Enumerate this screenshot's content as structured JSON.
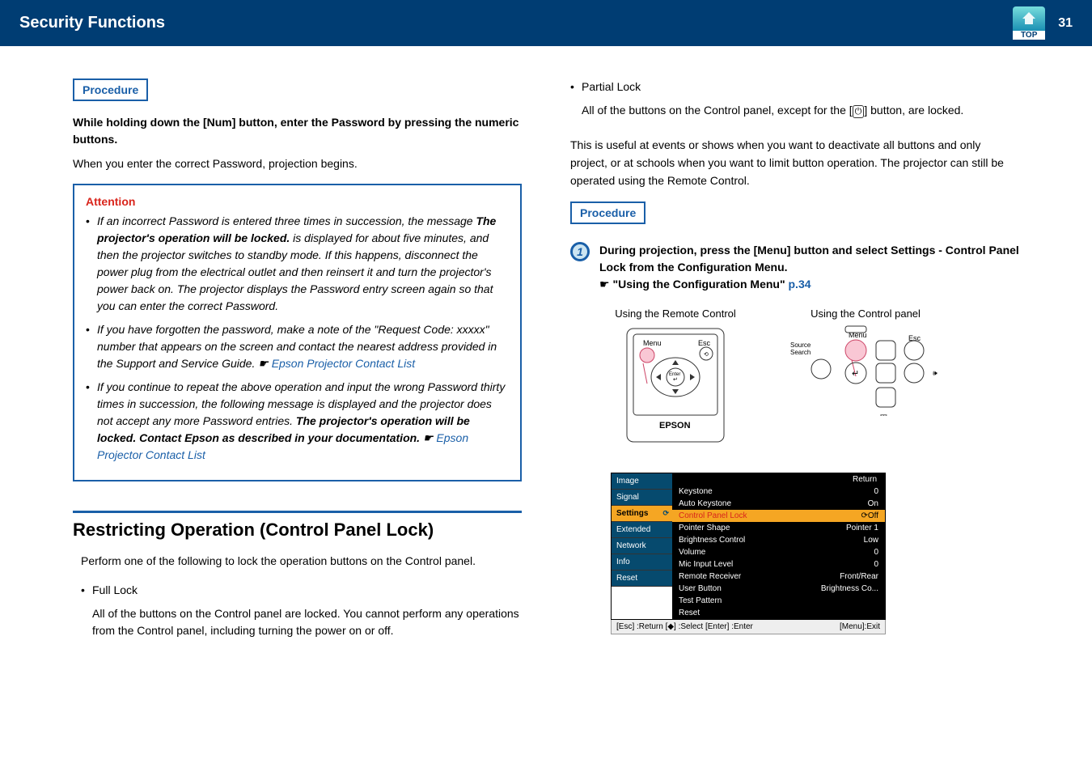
{
  "header": {
    "title": "Security Functions",
    "page": "31",
    "top": "TOP"
  },
  "left": {
    "procLabel": "Procedure",
    "instr": "While holding down the [Num] button, enter the Password by pressing the numeric buttons.",
    "after": "When you enter the correct Password, projection begins.",
    "attTitle": "Attention",
    "att1a": "If an incorrect Password is entered three times in succession, the message ",
    "att1b": "The projector's operation will be locked.",
    "att1c": " is displayed for about five minutes, and then the projector switches to standby mode. If this happens, disconnect the power plug from the electrical outlet and then reinsert it and turn the projector's power back on. The projector displays the Password entry screen again so that you can enter the correct Password.",
    "att2a": "If you have forgotten the password, make a note of the \"Request Code: xxxxx\" number that appears on the screen and contact the nearest address provided in the Support and Service Guide. ",
    "att2link": "Epson Projector Contact List",
    "att3a": "If you continue to repeat the above operation and input the wrong Password thirty times in succession, the following message is displayed and the projector does not accept any more Password entries. ",
    "att3b": "The projector's operation will be locked. Contact Epson as described in your documentation.",
    "att3link": "Epson Projector Contact List",
    "section": "Restricting Operation (Control Panel Lock)",
    "sectionIntro": "Perform one of the following to lock the operation buttons on the Control panel.",
    "full": "Full Lock",
    "fullBody": "All of the buttons on the Control panel are locked. You cannot perform any operations from the Control panel, including turning the power on or off."
  },
  "right": {
    "partial": "Partial Lock",
    "partialBody1": "All of the buttons on the Control panel, except for the [",
    "partialBody2": "] button, are locked.",
    "useful": "This is useful at events or shows when you want to deactivate all buttons and only project, or at schools when you want to limit button operation. The projector can still be operated using the Remote Control.",
    "procLabel": "Procedure",
    "stepNum": "1",
    "stepText": "During projection, press the [Menu] button and select Settings - Control Panel Lock from the Configuration Menu.",
    "cfgLink": "\"Using the Configuration Menu\"",
    "cfgPage": "p.34",
    "diagRemote": "Using the Remote Control",
    "diagPanel": "Using the Control panel",
    "remoteLabels": {
      "menu": "Menu",
      "esc": "Esc",
      "enter": "Enter",
      "brand": "EPSON"
    },
    "panelLabels": {
      "menu": "Menu",
      "esc": "Esc",
      "source": "Source\nSearch"
    },
    "menu": {
      "left": [
        "Image",
        "Signal",
        "Settings",
        "Extended",
        "Network",
        "Info",
        "Reset"
      ],
      "ret": "Return",
      "rows": [
        [
          "Keystone",
          "0"
        ],
        [
          "Auto Keystone",
          "On"
        ],
        [
          "Control Panel Lock",
          "⟳Off"
        ],
        [
          "Pointer Shape",
          "Pointer 1"
        ],
        [
          "Brightness Control",
          "Low"
        ],
        [
          "Volume",
          "0"
        ],
        [
          "Mic Input Level",
          "0"
        ],
        [
          "Remote Receiver",
          "Front/Rear"
        ],
        [
          "User Button",
          "Brightness Co..."
        ],
        [
          "Test Pattern",
          ""
        ],
        [
          "Reset",
          ""
        ]
      ],
      "bar": {
        "l": "[Esc] :Return  [◆] :Select  [Enter] :Enter",
        "r": "[Menu]:Exit"
      }
    }
  }
}
